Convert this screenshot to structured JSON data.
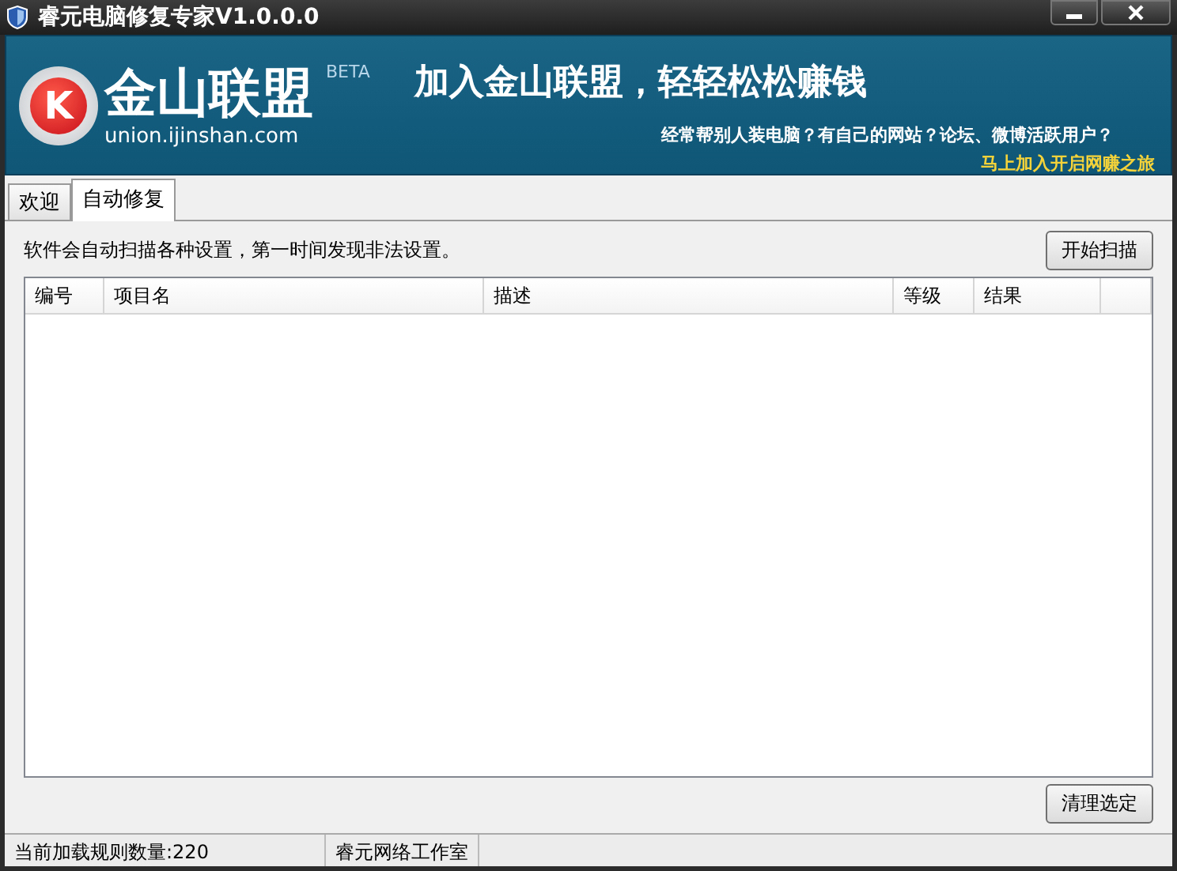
{
  "window": {
    "title": "睿元电脑修复专家V1.0.0.0",
    "controls": [
      {
        "kind": "minimize"
      },
      {
        "kind": "close"
      }
    ]
  },
  "banner": {
    "logo_text": "金山联盟",
    "logo_url": "union.ijinshan.com",
    "logo_badge": "BETA",
    "logo_letter": "K",
    "headline": "加入金山联盟，轻轻松松赚钱",
    "subline": "经常帮别人装电脑？有自己的网站？论坛、微博活跃用户？",
    "link": "马上加入开启网赚之旅"
  },
  "tabs": [
    {
      "label": "欢迎",
      "selected": false
    },
    {
      "label": "自动修复",
      "selected": true
    }
  ],
  "description": "软件会自动扫描各种设置，第一时间发现非法设置。",
  "scan_button": "开始扫描",
  "table": {
    "columns": [
      "编号",
      "项目名",
      "描述",
      "等级",
      "结果"
    ]
  },
  "clear_button": "清理选定",
  "status_bar": [
    "当前加载规则数量:220",
    "睿元网络工作室"
  ]
}
